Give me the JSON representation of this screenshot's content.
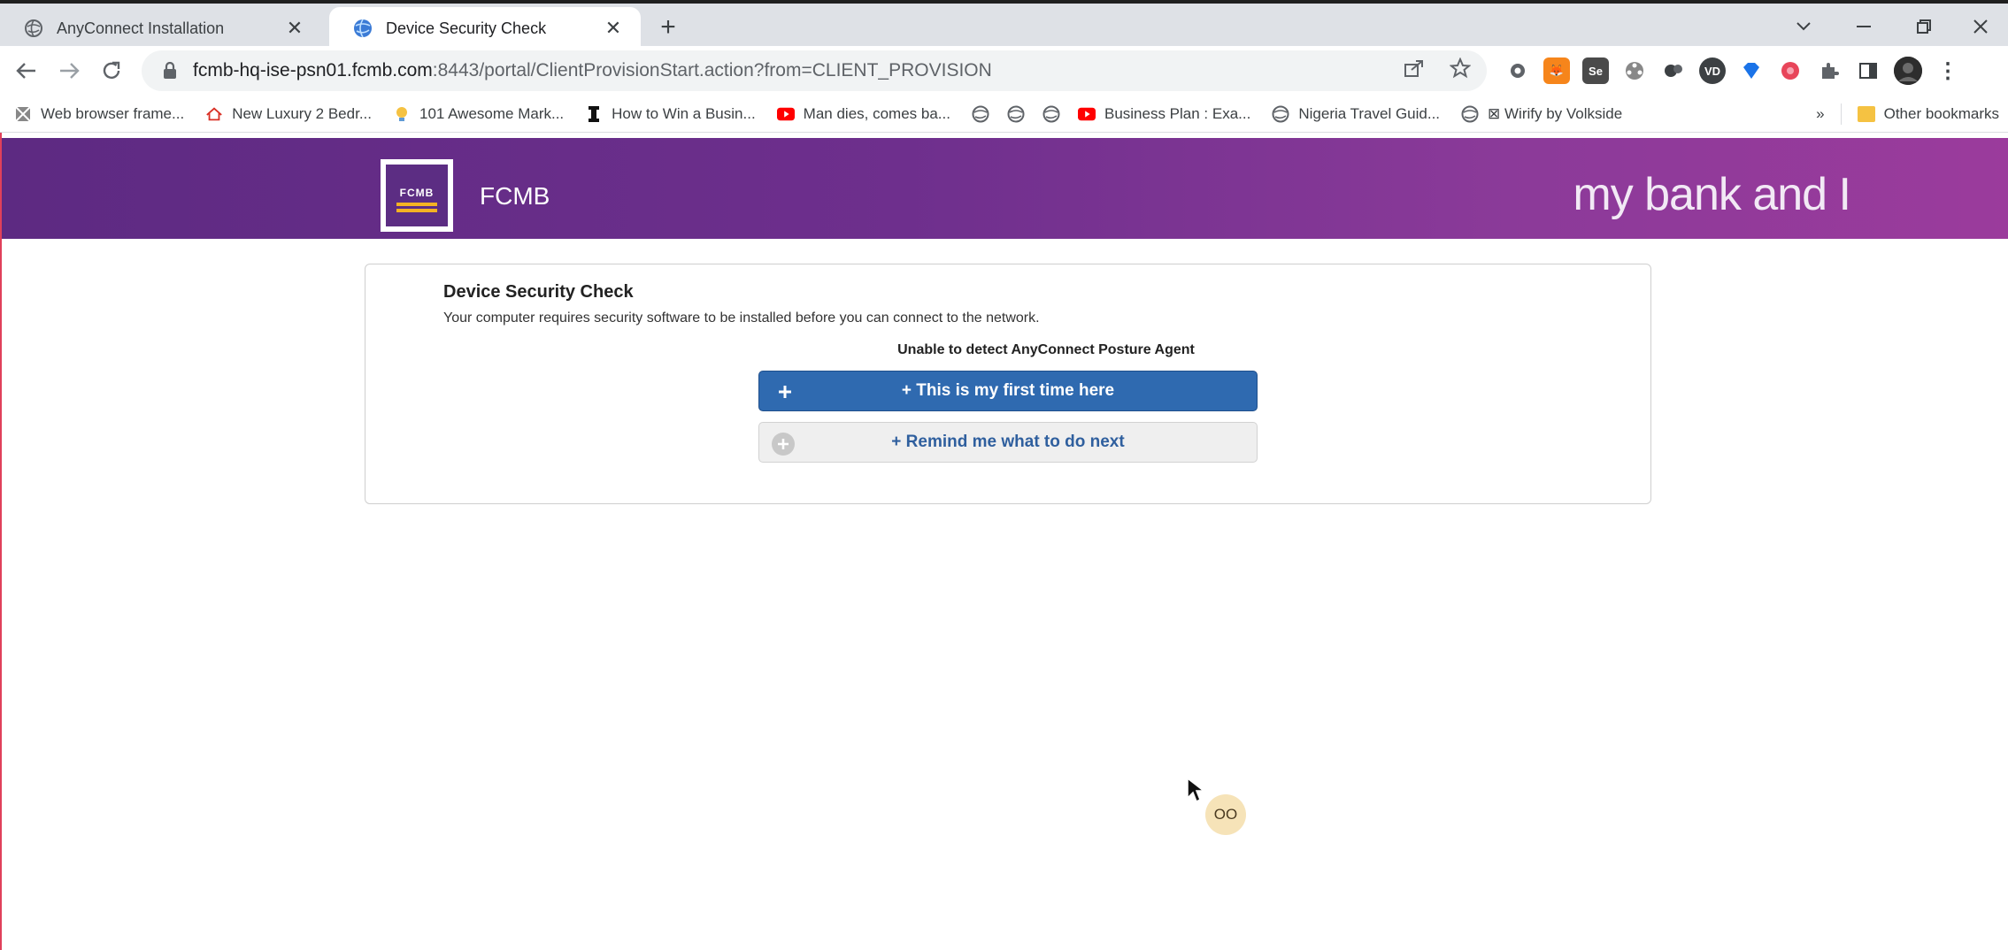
{
  "tabs": [
    {
      "title": "AnyConnect Installation",
      "active": false,
      "icon": "globe-icon"
    },
    {
      "title": "Device Security Check",
      "active": true,
      "icon": "globe-blue-icon"
    }
  ],
  "toolbar": {
    "url_host": "fcmb-hq-ise-psn01.fcmb.com",
    "url_rest": ":8443/portal/ClientProvisionStart.action?from=CLIENT_PROVISION"
  },
  "bookmarks": [
    {
      "label": "Web browser frame...",
      "icon": "image-icon"
    },
    {
      "label": "New Luxury 2 Bedr...",
      "icon": "house-icon"
    },
    {
      "label": "101 Awesome Mark...",
      "icon": "bulb-icon"
    },
    {
      "label": "How to Win a Busin...",
      "icon": "ibeam-icon"
    },
    {
      "label": "Man dies, comes ba...",
      "icon": "youtube-icon"
    },
    {
      "label": "",
      "icon": "globe-icon"
    },
    {
      "label": "",
      "icon": "globe-icon"
    },
    {
      "label": "",
      "icon": "globe-icon"
    },
    {
      "label": "Business Plan : Exa...",
      "icon": "youtube-icon"
    },
    {
      "label": "Nigeria Travel Guid...",
      "icon": "globe-icon"
    },
    {
      "label": "⊠ Wirify by Volkside",
      "icon": "globe-icon"
    }
  ],
  "bookmarks_more": "»",
  "other_bookmarks": "Other bookmarks",
  "banner": {
    "logo_text": "FCMB",
    "brand_name": "FCMB",
    "tagline": "my bank and I"
  },
  "card": {
    "title": "Device Security Check",
    "description": "Your computer requires security software to be installed before you can connect to the network.",
    "status": "Unable to detect AnyConnect Posture Agent",
    "primary_button": "+ This is my first time here",
    "secondary_button": "+ Remind me what to do next"
  },
  "overlay": {
    "badge_text": "OO"
  },
  "colors": {
    "banner_start": "#5d2a82",
    "banner_end": "#9b3b9c",
    "primary_button": "#2f6ab0",
    "secondary_text": "#2f5f9e"
  }
}
